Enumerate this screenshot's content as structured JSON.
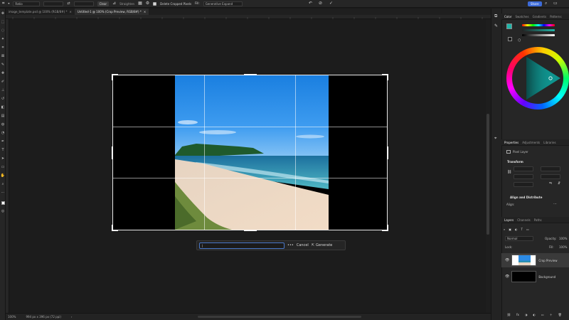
{
  "options_bar": {
    "ratio_label": "Ratio",
    "clear_label": "Clear",
    "straighten_label": "Straighten",
    "delete_cropped_label": "Delete Cropped Pixels",
    "fill_label": "Generative Expand",
    "share_label": "Share"
  },
  "tabs": [
    {
      "label": "image_template.psd @ 100% (RGB/8#) *"
    },
    {
      "label": "Untitled-1 @ 100% (Crop Preview, RGB/8#) *"
    }
  ],
  "status": {
    "zoom": "100%",
    "dimensions": "994 px x 396 px (72 ppi)"
  },
  "context_bar": {
    "prompt_value": "|",
    "more_label": "•••",
    "cancel_label": "Cancel",
    "generate_label": "Generate"
  },
  "color_panel": {
    "tabs": [
      "Color",
      "Swatches",
      "Gradients",
      "Patterns"
    ]
  },
  "properties_panel": {
    "tabs": [
      "Properties",
      "Adjustments",
      "Libraries"
    ],
    "pixel_layer_label": "Pixel Layer",
    "transform_heading": "Transform",
    "align_heading": "Align and Distribute",
    "align_label": "Align:"
  },
  "layers_panel": {
    "tabs": [
      "Layers",
      "Channels",
      "Paths"
    ],
    "blend_mode": "Normal",
    "opacity_label": "Opacity:",
    "opacity_value": "100%",
    "lock_label": "Lock:",
    "fill_label": "Fill:",
    "fill_value": "100%",
    "layers": [
      {
        "name": "Crop Preview"
      },
      {
        "name": "Background"
      }
    ]
  },
  "colors": {
    "accent_blue": "#3d6bd9",
    "foreground": "#1fb6a8",
    "hue_wheel_selected": "#16c7c0"
  }
}
